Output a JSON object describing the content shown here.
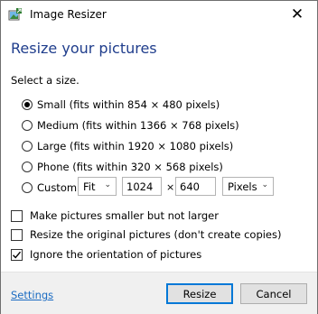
{
  "window": {
    "title": "Image Resizer",
    "close_glyph": "✕"
  },
  "heading": "Resize your pictures",
  "select_label": "Select a size.",
  "sizes": [
    {
      "label": "Small (fits within 854 × 480 pixels)",
      "checked": true
    },
    {
      "label": "Medium (fits within 1366 × 768 pixels)",
      "checked": false
    },
    {
      "label": "Large (fits within 1920 × 1080 pixels)",
      "checked": false
    },
    {
      "label": "Phone (fits within 320 × 568 pixels)",
      "checked": false
    }
  ],
  "custom": {
    "label": "Custom",
    "fit_value": "Fit",
    "width": "1024",
    "times": "×",
    "height": "640",
    "unit_value": "Pixels"
  },
  "options": [
    {
      "label": "Make pictures smaller but not larger",
      "checked": false
    },
    {
      "label": "Resize the original pictures (don't create copies)",
      "checked": false
    },
    {
      "label": "Ignore the orientation of pictures",
      "checked": true
    }
  ],
  "footer": {
    "settings_link": "Settings",
    "resize_button": "Resize",
    "cancel_button": "Cancel"
  },
  "colors": {
    "heading": "#1f3d8c",
    "link": "#1a6bc2",
    "accent": "#0078d7"
  },
  "icons": {
    "app": "image-resizer-icon",
    "check": "checkmark-icon",
    "chevron": "chevron-down-icon"
  }
}
